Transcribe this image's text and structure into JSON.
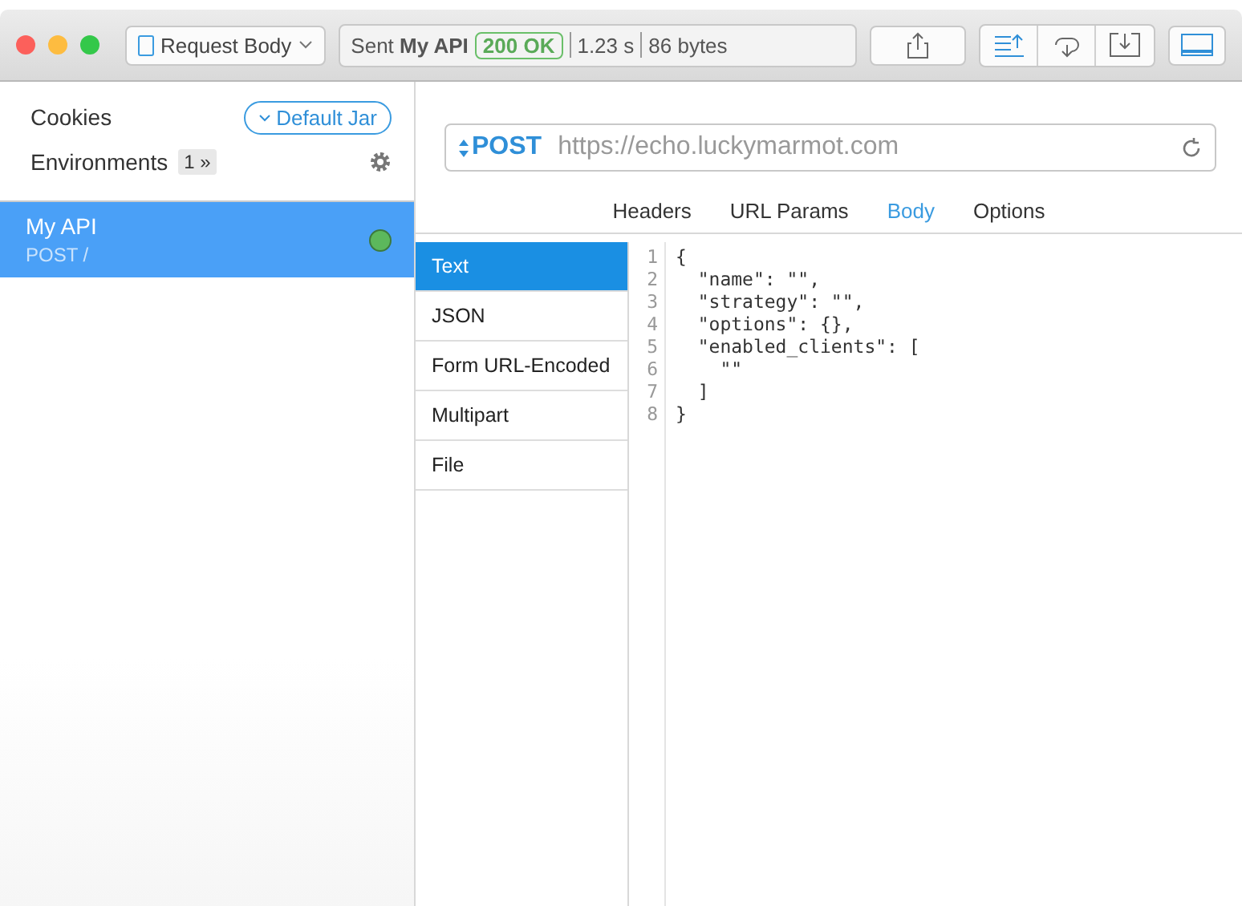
{
  "toolbar": {
    "body_menu": "Request Body",
    "status": {
      "sent": "Sent",
      "name": "My API",
      "code": "200 OK",
      "time": "1.23 s",
      "size": "86 bytes"
    }
  },
  "sidebar": {
    "cookies": {
      "label": "Cookies",
      "jar": "Default Jar"
    },
    "environments": {
      "label": "Environments",
      "count": "1 »"
    },
    "requests": [
      {
        "name": "My API",
        "path": "POST /",
        "selected": true,
        "color": "#5cb85c"
      }
    ]
  },
  "request": {
    "method": "POST",
    "url": "https://echo.luckymarmot.com"
  },
  "tabs": [
    {
      "label": "Headers",
      "selected": false
    },
    {
      "label": "URL Params",
      "selected": false
    },
    {
      "label": "Body",
      "selected": true
    },
    {
      "label": "Options",
      "selected": false
    }
  ],
  "body_types": [
    {
      "label": "Text",
      "selected": true
    },
    {
      "label": "JSON",
      "selected": false
    },
    {
      "label": "Form URL-Encoded",
      "selected": false
    },
    {
      "label": "Multipart",
      "selected": false
    },
    {
      "label": "File",
      "selected": false
    }
  ],
  "editor": {
    "lines": [
      {
        "number": "1",
        "text": "{"
      },
      {
        "number": "2",
        "text": "  \"name\": \"\","
      },
      {
        "number": "3",
        "text": "  \"strategy\": \"\","
      },
      {
        "number": "4",
        "text": "  \"options\": {},"
      },
      {
        "number": "5",
        "text": "  \"enabled_clients\": ["
      },
      {
        "number": "6",
        "text": "    \"\""
      },
      {
        "number": "7",
        "text": "  ]"
      },
      {
        "number": "8",
        "text": "}"
      }
    ]
  }
}
